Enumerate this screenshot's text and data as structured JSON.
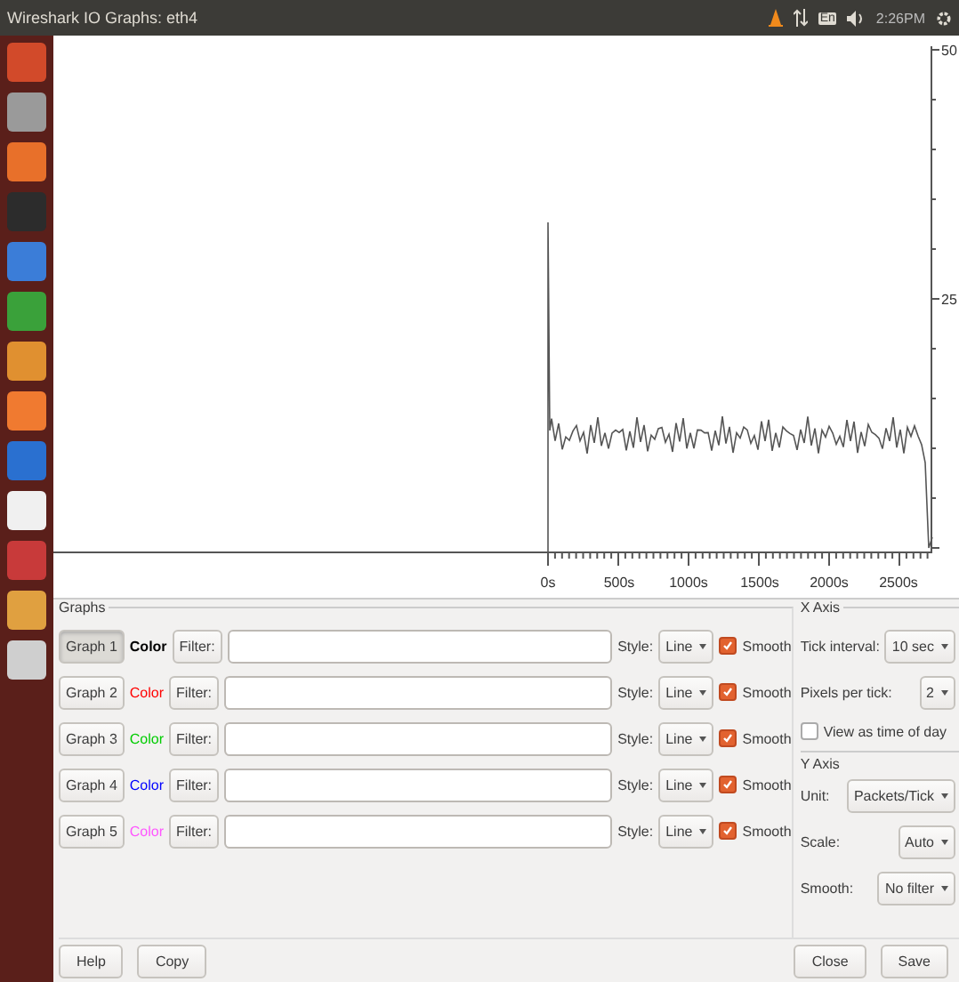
{
  "window": {
    "title": "Wireshark IO Graphs: eth4"
  },
  "top_bar": {
    "keyboard": "En",
    "clock": "2:26PM"
  },
  "plot": {
    "x_tick_labels": [
      "0s",
      "500s",
      "1000s",
      "1500s",
      "2000s",
      "2500s"
    ],
    "y_tick_labels": [
      "50",
      "25"
    ]
  },
  "graphs_group": {
    "title": "Graphs",
    "rows": [
      {
        "button": "Graph 1",
        "on": true,
        "color_label": "Color",
        "color": "#000000",
        "filter_button": "Filter:",
        "style_label": "Style:",
        "style": "Line",
        "smooth_label": "Smooth",
        "smooth": true
      },
      {
        "button": "Graph 2",
        "on": false,
        "color_label": "Color",
        "color": "#ff0000",
        "filter_button": "Filter:",
        "style_label": "Style:",
        "style": "Line",
        "smooth_label": "Smooth",
        "smooth": true
      },
      {
        "button": "Graph 3",
        "on": false,
        "color_label": "Color",
        "color": "#00cc00",
        "filter_button": "Filter:",
        "style_label": "Style:",
        "style": "Line",
        "smooth_label": "Smooth",
        "smooth": true
      },
      {
        "button": "Graph 4",
        "on": false,
        "color_label": "Color",
        "color": "#0000ff",
        "filter_button": "Filter:",
        "style_label": "Style:",
        "style": "Line",
        "smooth_label": "Smooth",
        "smooth": true
      },
      {
        "button": "Graph 5",
        "on": false,
        "color_label": "Color",
        "color": "#ff55ff",
        "filter_button": "Filter:",
        "style_label": "Style:",
        "style": "Line",
        "smooth_label": "Smooth",
        "smooth": true
      }
    ]
  },
  "x_axis": {
    "title": "X Axis",
    "tick_interval_label": "Tick interval:",
    "tick_interval": "10 sec",
    "pixels_label": "Pixels per tick:",
    "pixels": "2",
    "time_of_day_label": "View as time of day",
    "time_of_day": false
  },
  "y_axis": {
    "title": "Y Axis",
    "unit_label": "Unit:",
    "unit": "Packets/Tick",
    "scale_label": "Scale:",
    "scale": "Auto",
    "smooth_label": "Smooth:",
    "smooth": "No filter"
  },
  "buttons_left": [
    "Help",
    "Copy"
  ],
  "buttons_right": [
    "Close",
    "Save"
  ]
}
